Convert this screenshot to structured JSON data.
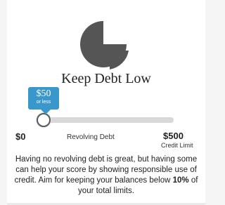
{
  "title": "Keep Debt Low",
  "slider": {
    "value": 50,
    "min": 0,
    "max": 500,
    "tooltip_value": "$50",
    "tooltip_sub": "or less",
    "min_label": "$0",
    "middle_label": "Revolving Debt",
    "max_label": "$500",
    "max_sub_label": "Credit Limit"
  },
  "description": {
    "text_before": "Having no revolving debt is great, but having some can help your score by showing responsible use of credit. Aim for keeping your balances below ",
    "highlight": "10%",
    "text_after": " of your total limits."
  },
  "icons": {
    "pie_icon_color": "#555555"
  },
  "colors": {
    "tooltip_bg": "#3a97cc"
  }
}
